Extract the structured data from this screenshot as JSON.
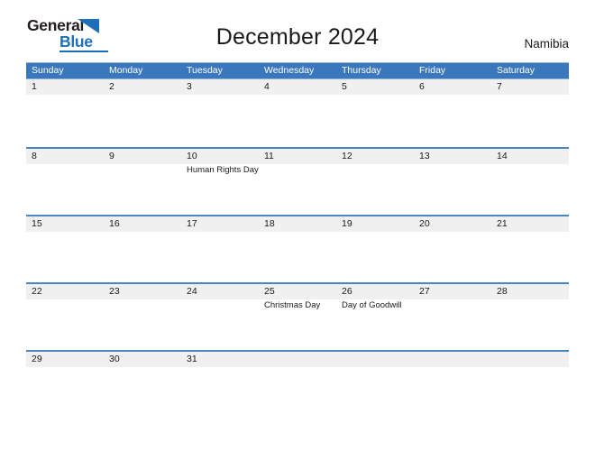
{
  "brand": {
    "name_part1": "General",
    "name_part2": "Blue",
    "triangle_color": "#1e6fba",
    "text_color": "#231f20",
    "accent_color": "#1e6fba"
  },
  "header": {
    "title": "December 2024",
    "country": "Namibia"
  },
  "colors": {
    "header_blue": "#3a77bd",
    "row_separator_blue": "#4a85c5",
    "date_band_gray": "#f0f0f0",
    "text": "#1a1a1a"
  },
  "calendar": {
    "weekdays": [
      "Sunday",
      "Monday",
      "Tuesday",
      "Wednesday",
      "Thursday",
      "Friday",
      "Saturday"
    ],
    "weeks": [
      [
        {
          "date": "1",
          "events": []
        },
        {
          "date": "2",
          "events": []
        },
        {
          "date": "3",
          "events": []
        },
        {
          "date": "4",
          "events": []
        },
        {
          "date": "5",
          "events": []
        },
        {
          "date": "6",
          "events": []
        },
        {
          "date": "7",
          "events": []
        }
      ],
      [
        {
          "date": "8",
          "events": []
        },
        {
          "date": "9",
          "events": []
        },
        {
          "date": "10",
          "events": [
            "Human Rights Day"
          ]
        },
        {
          "date": "11",
          "events": []
        },
        {
          "date": "12",
          "events": []
        },
        {
          "date": "13",
          "events": []
        },
        {
          "date": "14",
          "events": []
        }
      ],
      [
        {
          "date": "15",
          "events": []
        },
        {
          "date": "16",
          "events": []
        },
        {
          "date": "17",
          "events": []
        },
        {
          "date": "18",
          "events": []
        },
        {
          "date": "19",
          "events": []
        },
        {
          "date": "20",
          "events": []
        },
        {
          "date": "21",
          "events": []
        }
      ],
      [
        {
          "date": "22",
          "events": []
        },
        {
          "date": "23",
          "events": []
        },
        {
          "date": "24",
          "events": []
        },
        {
          "date": "25",
          "events": [
            "Christmas Day"
          ]
        },
        {
          "date": "26",
          "events": [
            "Day of Goodwill"
          ]
        },
        {
          "date": "27",
          "events": []
        },
        {
          "date": "28",
          "events": []
        }
      ],
      [
        {
          "date": "29",
          "events": []
        },
        {
          "date": "30",
          "events": []
        },
        {
          "date": "31",
          "events": []
        },
        {
          "date": "",
          "events": []
        },
        {
          "date": "",
          "events": []
        },
        {
          "date": "",
          "events": []
        },
        {
          "date": "",
          "events": []
        }
      ]
    ]
  }
}
